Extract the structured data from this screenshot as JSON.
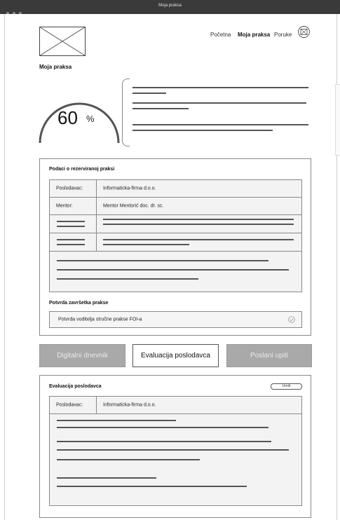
{
  "window": {
    "title": "Moja praksa"
  },
  "header": {
    "nav": [
      {
        "label": "Početna",
        "active": false
      },
      {
        "label": "Moja praksa",
        "active": true
      },
      {
        "label": "Poruke",
        "active": false
      }
    ],
    "logo_icon": "image-placeholder-icon",
    "messages_icon": "mail-icon"
  },
  "page": {
    "title": "Moja praksa"
  },
  "progress": {
    "value": "60",
    "unit": "%",
    "fraction": 0.6
  },
  "reservation": {
    "title": "Podaci o rezerviranoj praksi",
    "rows": [
      {
        "label": "Poslodavac:",
        "value": "Informaticka-firma d.o.o."
      },
      {
        "label": "Mentor:",
        "value": "Mentor Mentorić doc. dr. sc."
      }
    ]
  },
  "completion": {
    "title": "Potvrda završetka prakse",
    "item": "Potvrda voditelja stručne prakse FOI-a",
    "check_icon": "check-circle-icon"
  },
  "actions": {
    "diary": "Digitalni dnevnik",
    "evaluation": "Evaluacija poslodavca",
    "sent": "Poslani upiti"
  },
  "evaluation": {
    "title": "Evaluacija poslodavca",
    "edit_label": "Uredi",
    "row": {
      "label": "Poslodavac:",
      "value": "Informaticka-firma d.o.o."
    }
  },
  "colors": {
    "titlebar": "#3a3a3a",
    "disabled_button": "#a9a9a9",
    "border": "#888888"
  }
}
